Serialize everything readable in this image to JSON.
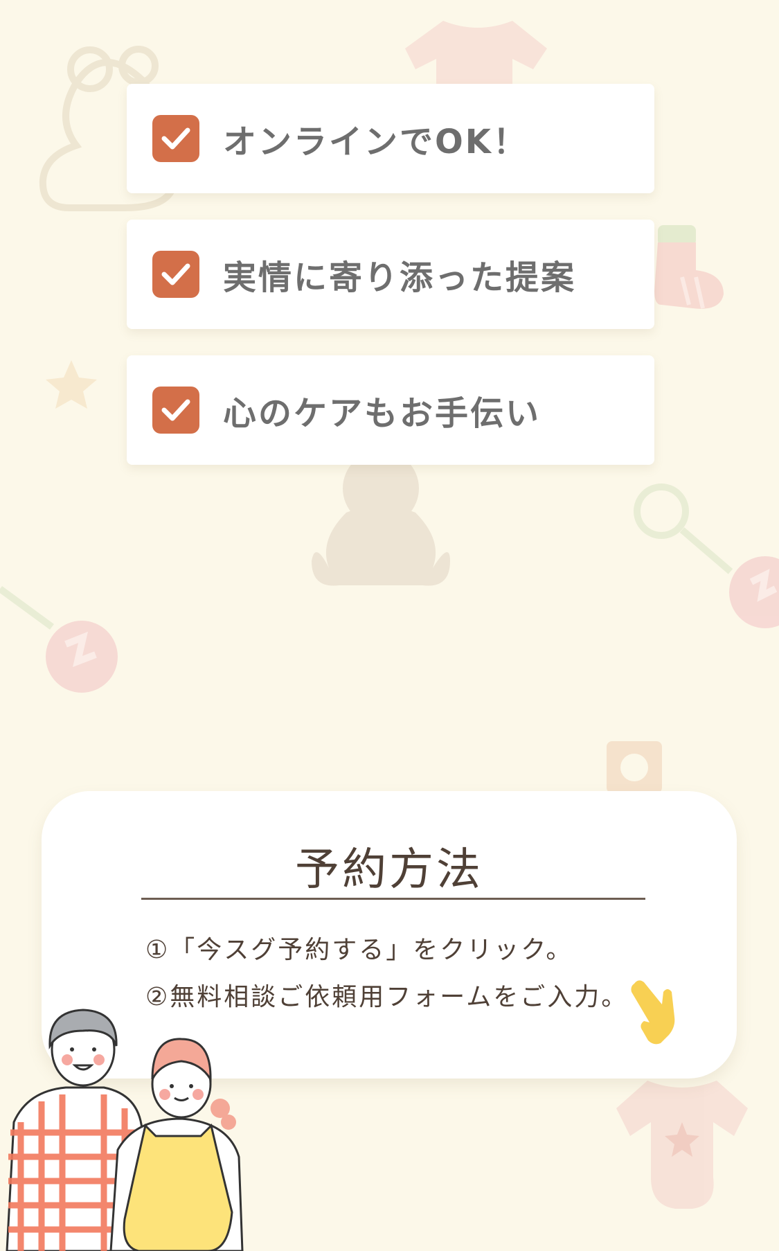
{
  "checklist": {
    "items": [
      {
        "label": "オンラインでOK！"
      },
      {
        "label": "実情に寄り添った提案"
      },
      {
        "label": "心のケアもお手伝い"
      }
    ],
    "icon": "checkbox-checked-icon"
  },
  "reservation": {
    "title": "予約方法",
    "steps": [
      "①「今スグ予約する」をクリック。",
      "②無料相談ご依頼用フォームをご入力。"
    ],
    "pointer_icon": "pointing-hand-icon"
  },
  "colors": {
    "background": "#fcf8e9",
    "accent": "#d36f49",
    "text_gray": "#6e6e6e",
    "text_brown": "#4f4036"
  }
}
